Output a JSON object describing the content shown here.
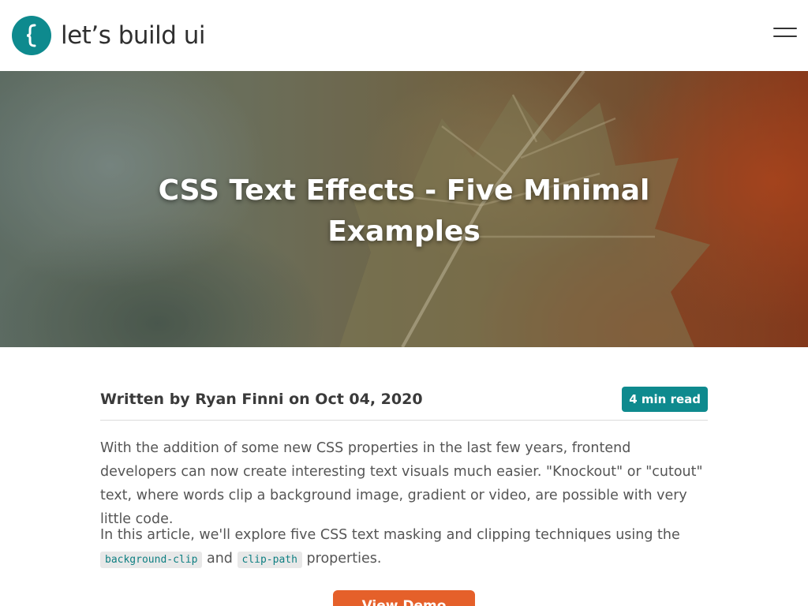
{
  "header": {
    "logo_text": "let’s build ui",
    "logo_icon": "curly-brace-icon",
    "menu_icon": "hamburger-menu-icon"
  },
  "hero": {
    "title": "CSS Text Effects - Five Minimal Examples"
  },
  "article": {
    "byline": "Written by Ryan Finni on Oct 04, 2020",
    "read_time": "4 min read",
    "paragraph1": "With the addition of some new CSS properties in the last few years, frontend developers can now create interesting text visuals much easier. \"Knockout\" or \"cutout\" text, where words clip a background image, gradient or video, are possible with very little code.",
    "paragraph2_start": "In this article, we'll explore five CSS text masking and clipping techniques using the",
    "code1": "background-clip",
    "paragraph2_mid": "and",
    "code2": "clip-path",
    "paragraph2_end": "properties.",
    "cta_label": "View Demo"
  },
  "colors": {
    "accent": "#0e8a8e",
    "cta": "#e5602a"
  }
}
